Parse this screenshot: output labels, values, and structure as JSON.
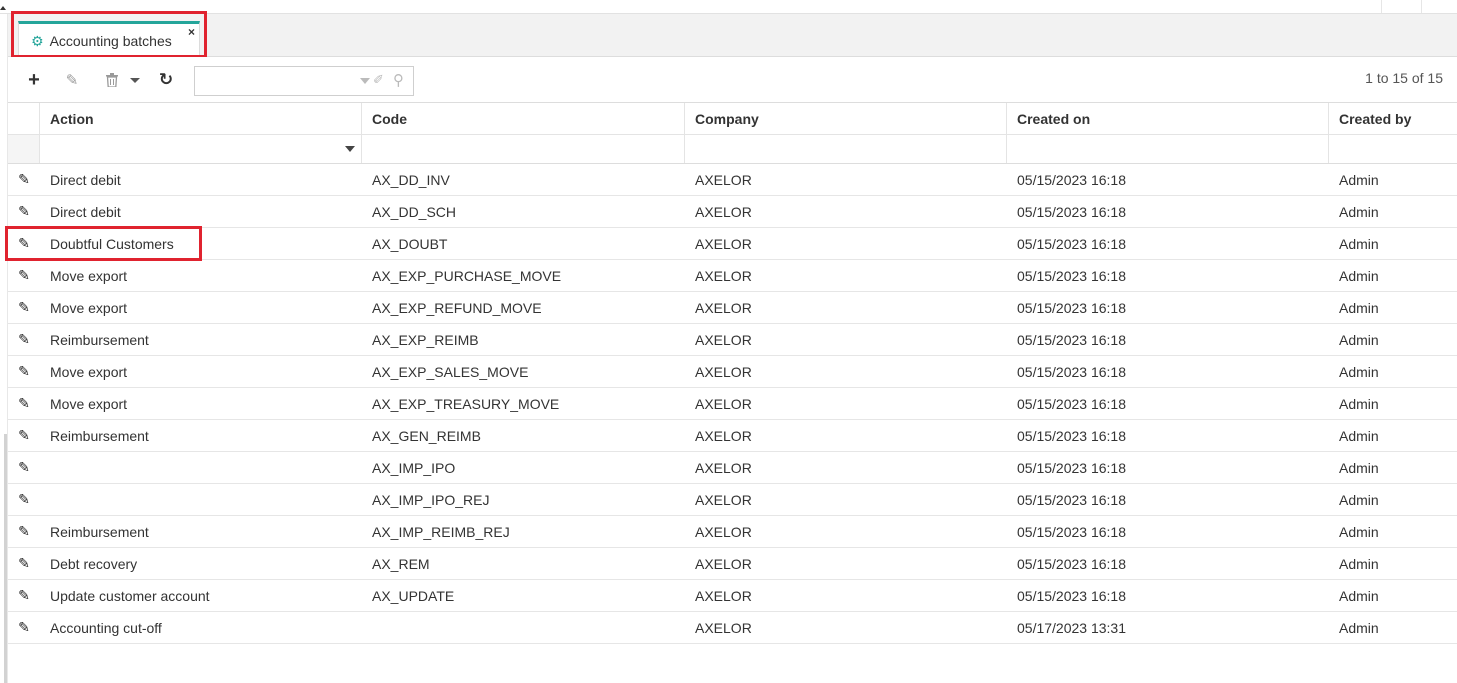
{
  "tab": {
    "title": "Accounting batches",
    "close_glyph": "×",
    "icon": "gear-icon"
  },
  "toolbar": {
    "add_icon": "plus-icon",
    "edit_icon": "pencil-icon",
    "delete_icon": "trash-icon",
    "refresh_icon": "refresh-icon",
    "search_value": "",
    "pager_text": "1 to 15 of 15"
  },
  "grid": {
    "columns": {
      "action": "Action",
      "code": "Code",
      "company": "Company",
      "created_on": "Created on",
      "created_by": "Created by"
    },
    "rows": [
      {
        "action": "Direct debit",
        "code": "AX_DD_INV",
        "company": "AXELOR",
        "created_on": "05/15/2023 16:18",
        "created_by": "Admin"
      },
      {
        "action": "Direct debit",
        "code": "AX_DD_SCH",
        "company": "AXELOR",
        "created_on": "05/15/2023 16:18",
        "created_by": "Admin"
      },
      {
        "action": "Doubtful Customers",
        "code": "AX_DOUBT",
        "company": "AXELOR",
        "created_on": "05/15/2023 16:18",
        "created_by": "Admin"
      },
      {
        "action": "Move export",
        "code": "AX_EXP_PURCHASE_MOVE",
        "company": "AXELOR",
        "created_on": "05/15/2023 16:18",
        "created_by": "Admin"
      },
      {
        "action": "Move export",
        "code": "AX_EXP_REFUND_MOVE",
        "company": "AXELOR",
        "created_on": "05/15/2023 16:18",
        "created_by": "Admin"
      },
      {
        "action": "Reimbursement",
        "code": "AX_EXP_REIMB",
        "company": "AXELOR",
        "created_on": "05/15/2023 16:18",
        "created_by": "Admin"
      },
      {
        "action": "Move export",
        "code": "AX_EXP_SALES_MOVE",
        "company": "AXELOR",
        "created_on": "05/15/2023 16:18",
        "created_by": "Admin"
      },
      {
        "action": "Move export",
        "code": "AX_EXP_TREASURY_MOVE",
        "company": "AXELOR",
        "created_on": "05/15/2023 16:18",
        "created_by": "Admin"
      },
      {
        "action": "Reimbursement",
        "code": "AX_GEN_REIMB",
        "company": "AXELOR",
        "created_on": "05/15/2023 16:18",
        "created_by": "Admin"
      },
      {
        "action": "",
        "code": "AX_IMP_IPO",
        "company": "AXELOR",
        "created_on": "05/15/2023 16:18",
        "created_by": "Admin"
      },
      {
        "action": "",
        "code": "AX_IMP_IPO_REJ",
        "company": "AXELOR",
        "created_on": "05/15/2023 16:18",
        "created_by": "Admin"
      },
      {
        "action": "Reimbursement",
        "code": "AX_IMP_REIMB_REJ",
        "company": "AXELOR",
        "created_on": "05/15/2023 16:18",
        "created_by": "Admin"
      },
      {
        "action": "Debt recovery",
        "code": "AX_REM",
        "company": "AXELOR",
        "created_on": "05/15/2023 16:18",
        "created_by": "Admin"
      },
      {
        "action": "Update customer account",
        "code": "AX_UPDATE",
        "company": "AXELOR",
        "created_on": "05/15/2023 16:18",
        "created_by": "Admin"
      },
      {
        "action": "Accounting cut-off",
        "code": "",
        "company": "AXELOR",
        "created_on": "05/17/2023 13:31",
        "created_by": "Admin"
      }
    ]
  },
  "colors": {
    "accent": "#24a59a",
    "highlight": "#e0232f"
  }
}
